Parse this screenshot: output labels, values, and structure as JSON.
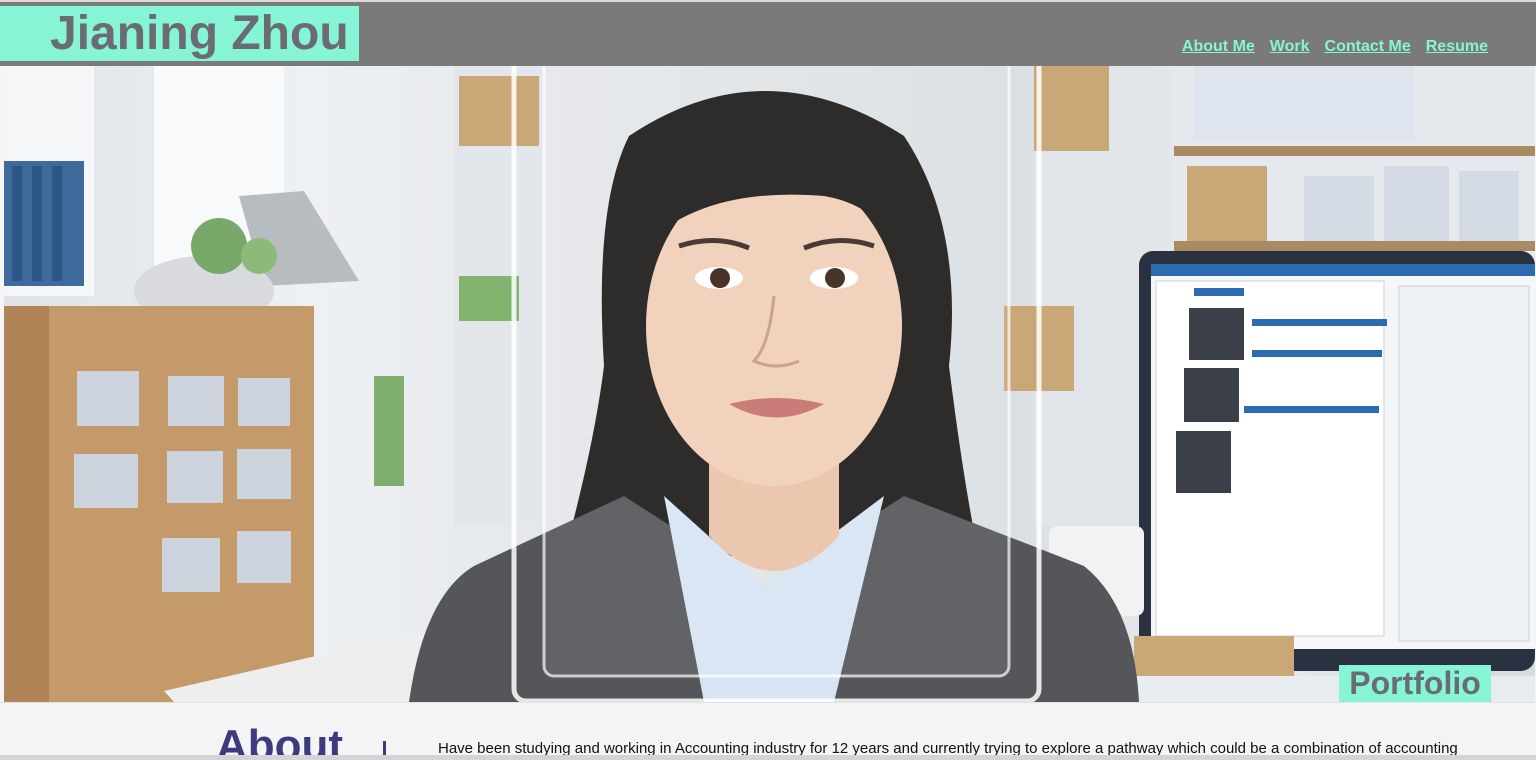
{
  "header": {
    "logo_text": "Jianing Zhou",
    "nav": [
      {
        "label": "About Me"
      },
      {
        "label": "Work"
      },
      {
        "label": "Contact Me"
      },
      {
        "label": "Resume"
      }
    ]
  },
  "hero": {
    "badge_text": "Portfolio"
  },
  "about": {
    "title": "About",
    "body": "Have been studying and working in Accounting industry for 12 years and currently trying to explore a pathway which could be a combination of accounting"
  },
  "colors": {
    "accent": "#86f5d6",
    "header_bg": "#7a7a7a",
    "logo_text": "#6b6b73",
    "about_title": "#3d3a80"
  }
}
